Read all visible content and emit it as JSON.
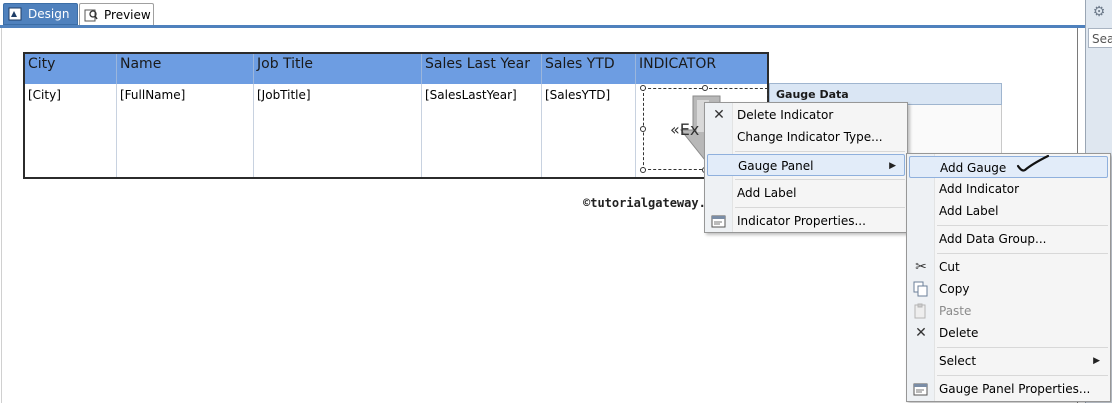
{
  "tabs": [
    {
      "label": "Design",
      "icon": "design-icon"
    },
    {
      "label": "Preview",
      "icon": "preview-icon"
    }
  ],
  "sidebar": {
    "search_text": "Sear",
    "gear_icon": "gear-icon"
  },
  "table": {
    "headers": [
      "City",
      "Name",
      "Job Title",
      "Sales Last Year",
      "Sales YTD",
      "INDICATOR"
    ],
    "row": [
      "[City]",
      "[FullName]",
      "[JobTitle]",
      "[SalesLastYear]",
      "[SalesYTD]",
      ""
    ]
  },
  "indicator": {
    "expression_text": "«Ex"
  },
  "gauge_data": {
    "title": "Gauge Data"
  },
  "watermark": "©tutorialgateway.org",
  "context_menu": {
    "items": [
      {
        "label": "Delete Indicator",
        "icon": "delete-x-icon"
      },
      {
        "label": "Change Indicator Type..."
      },
      {
        "label": "Gauge Panel",
        "submenu": true,
        "highlighted": true
      },
      {
        "label": "Add Label"
      },
      {
        "label": "Indicator Properties...",
        "icon": "properties-icon"
      }
    ]
  },
  "submenu": {
    "items": [
      {
        "label": "Add Gauge",
        "highlighted": true
      },
      {
        "label": "Add Indicator"
      },
      {
        "label": "Add Label"
      },
      {
        "label": "Add Data Group..."
      },
      {
        "label": "Cut",
        "icon": "scissors-icon"
      },
      {
        "label": "Copy",
        "icon": "copy-icon"
      },
      {
        "label": "Paste",
        "icon": "paste-icon",
        "disabled": true
      },
      {
        "label": "Delete",
        "icon": "delete-x-icon"
      },
      {
        "label": "Select",
        "submenu": true
      },
      {
        "label": "Gauge Panel Properties...",
        "icon": "properties-icon"
      }
    ]
  },
  "colors": {
    "header_blue": "#6d9de2",
    "tab_blue": "#4f81bd",
    "menu_highlight": "#e2ecf9"
  }
}
